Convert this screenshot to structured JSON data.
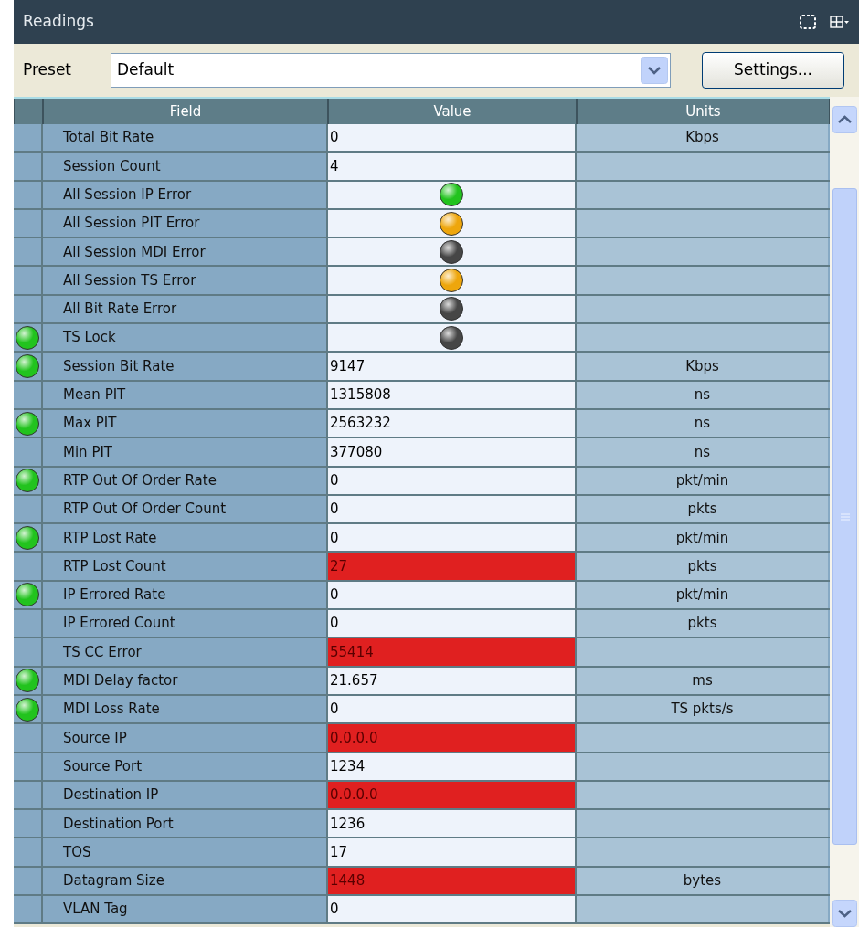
{
  "panel": {
    "title": "Readings"
  },
  "preset": {
    "label": "Preset",
    "value": "Default",
    "button": "Settings..."
  },
  "table": {
    "columns": [
      "Field",
      "Value",
      "Units"
    ],
    "rows": [
      {
        "field": "Total Bit Rate",
        "kind": "text",
        "value": "0",
        "alert": false,
        "units": "Kbps",
        "ok_lamp": false
      },
      {
        "field": "Session Count",
        "kind": "text",
        "value": "4",
        "alert": false,
        "ok_lamp": false
      },
      {
        "field": "All Session IP Error",
        "kind": "lamp",
        "color": "#22c31e",
        "ok_lamp": false
      },
      {
        "field": "All Session PIT Error",
        "kind": "lamp",
        "color": "#eea60c",
        "ok_lamp": false
      },
      {
        "field": "All Session MDI Error",
        "kind": "lamp",
        "color": "#464646",
        "ok_lamp": false
      },
      {
        "field": "All Session TS Error",
        "kind": "lamp",
        "color": "#eea60c",
        "ok_lamp": false
      },
      {
        "field": "All Bit Rate Error",
        "kind": "lamp",
        "color": "#464646",
        "ok_lamp": false
      },
      {
        "field": "TS Lock",
        "kind": "lamp",
        "color": "#464646",
        "ok_lamp": true
      },
      {
        "field": "Session Bit Rate",
        "kind": "text",
        "value": "9147",
        "alert": false,
        "units": "Kbps",
        "ok_lamp": true
      },
      {
        "field": "Mean PIT",
        "kind": "text",
        "value": "1315808",
        "alert": false,
        "units": "ns",
        "ok_lamp": false
      },
      {
        "field": "Max PIT",
        "kind": "text",
        "value": "2563232",
        "alert": false,
        "units": "ns",
        "ok_lamp": true
      },
      {
        "field": "Min PIT",
        "kind": "text",
        "value": "377080",
        "alert": false,
        "units": "ns",
        "ok_lamp": false
      },
      {
        "field": "RTP Out Of Order Rate",
        "kind": "text",
        "value": "0",
        "alert": false,
        "units": "pkt/min",
        "ok_lamp": true
      },
      {
        "field": "RTP Out Of Order Count",
        "kind": "text",
        "value": "0",
        "alert": false,
        "units": "pkts",
        "ok_lamp": false
      },
      {
        "field": "RTP Lost Rate",
        "kind": "text",
        "value": "0",
        "alert": false,
        "units": "pkt/min",
        "ok_lamp": true
      },
      {
        "field": "RTP Lost Count",
        "kind": "text",
        "value": "27",
        "alert": true,
        "units": "pkts",
        "ok_lamp": false
      },
      {
        "field": "IP Errored Rate",
        "kind": "text",
        "value": "0",
        "alert": false,
        "units": "pkt/min",
        "ok_lamp": true
      },
      {
        "field": "IP Errored Count",
        "kind": "text",
        "value": "0",
        "alert": false,
        "units": "pkts",
        "ok_lamp": false
      },
      {
        "field": "TS CC Error",
        "kind": "text",
        "value": "55414",
        "alert": true,
        "ok_lamp": false
      },
      {
        "field": "MDI Delay factor",
        "kind": "text",
        "value": "21.657",
        "alert": false,
        "units": "ms",
        "ok_lamp": true
      },
      {
        "field": "MDI Loss Rate",
        "kind": "text",
        "value": "0",
        "alert": false,
        "units": "TS pkts/s",
        "ok_lamp": true
      },
      {
        "field": "Source IP",
        "kind": "text",
        "value": "0.0.0.0",
        "alert": true,
        "ok_lamp": false
      },
      {
        "field": "Source Port",
        "kind": "text",
        "value": "1234",
        "alert": false,
        "ok_lamp": false
      },
      {
        "field": "Destination IP",
        "kind": "text",
        "value": "0.0.0.0",
        "alert": true,
        "ok_lamp": false
      },
      {
        "field": "Destination Port",
        "kind": "text",
        "value": "1236",
        "alert": false,
        "ok_lamp": false
      },
      {
        "field": "TOS",
        "kind": "text",
        "value": "17",
        "alert": false,
        "ok_lamp": false
      },
      {
        "field": "Datagram Size",
        "kind": "text",
        "value": "1448",
        "alert": true,
        "units": "bytes",
        "ok_lamp": false
      },
      {
        "field": "VLAN Tag",
        "kind": "text",
        "value": "0",
        "alert": false,
        "ok_lamp": false
      }
    ]
  }
}
